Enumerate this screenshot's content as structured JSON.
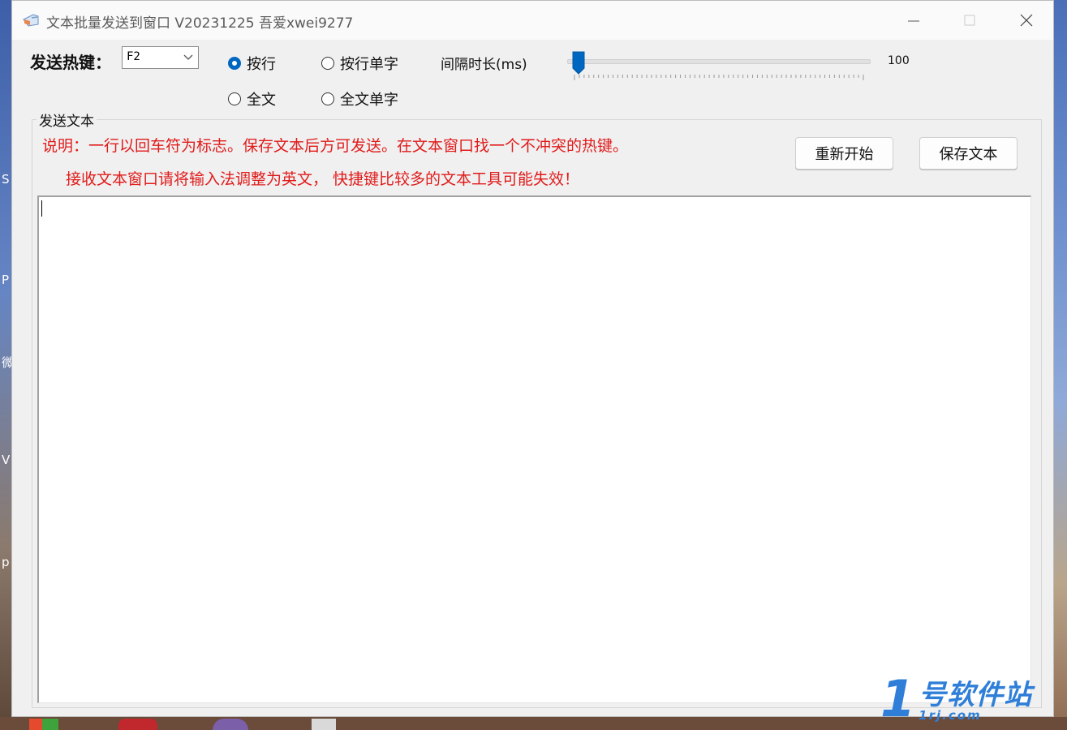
{
  "window": {
    "title": "文本批量发送到窗口 V20231225 吾爱xwei9277",
    "controls": {
      "minimize": "minimize",
      "maximize": "maximize",
      "close": "close"
    }
  },
  "hotkey": {
    "label": "发送热键：",
    "selected": "F2"
  },
  "mode": {
    "options": [
      {
        "label": "按行",
        "checked": true
      },
      {
        "label": "按行单字",
        "checked": false
      },
      {
        "label": "全文",
        "checked": false
      },
      {
        "label": "全文单字",
        "checked": false
      }
    ]
  },
  "interval": {
    "label": "间隔时长(ms)",
    "value": "100",
    "slider_fraction": 0.0
  },
  "group": {
    "legend": "发送文本",
    "note_line1": "说明：一行以回车符为标志。保存文本后方可发送。在文本窗口找一个不冲突的热键。",
    "note_line2": "接收文本窗口请将输入法调整为英文， 快捷键比较多的文本工具可能失效！",
    "restart_button": "重新开始",
    "save_button": "保存文本",
    "text_content": ""
  },
  "desktop": {
    "left_edge_chars": [
      "S",
      "P",
      "微",
      "V",
      "p"
    ],
    "watermark": {
      "big": "1",
      "top": "号软件站",
      "bottom": "1rj.com"
    }
  },
  "colors": {
    "accent": "#0067c0",
    "note_red": "#e11b1b",
    "watermark_blue": "#2f7fd8"
  }
}
